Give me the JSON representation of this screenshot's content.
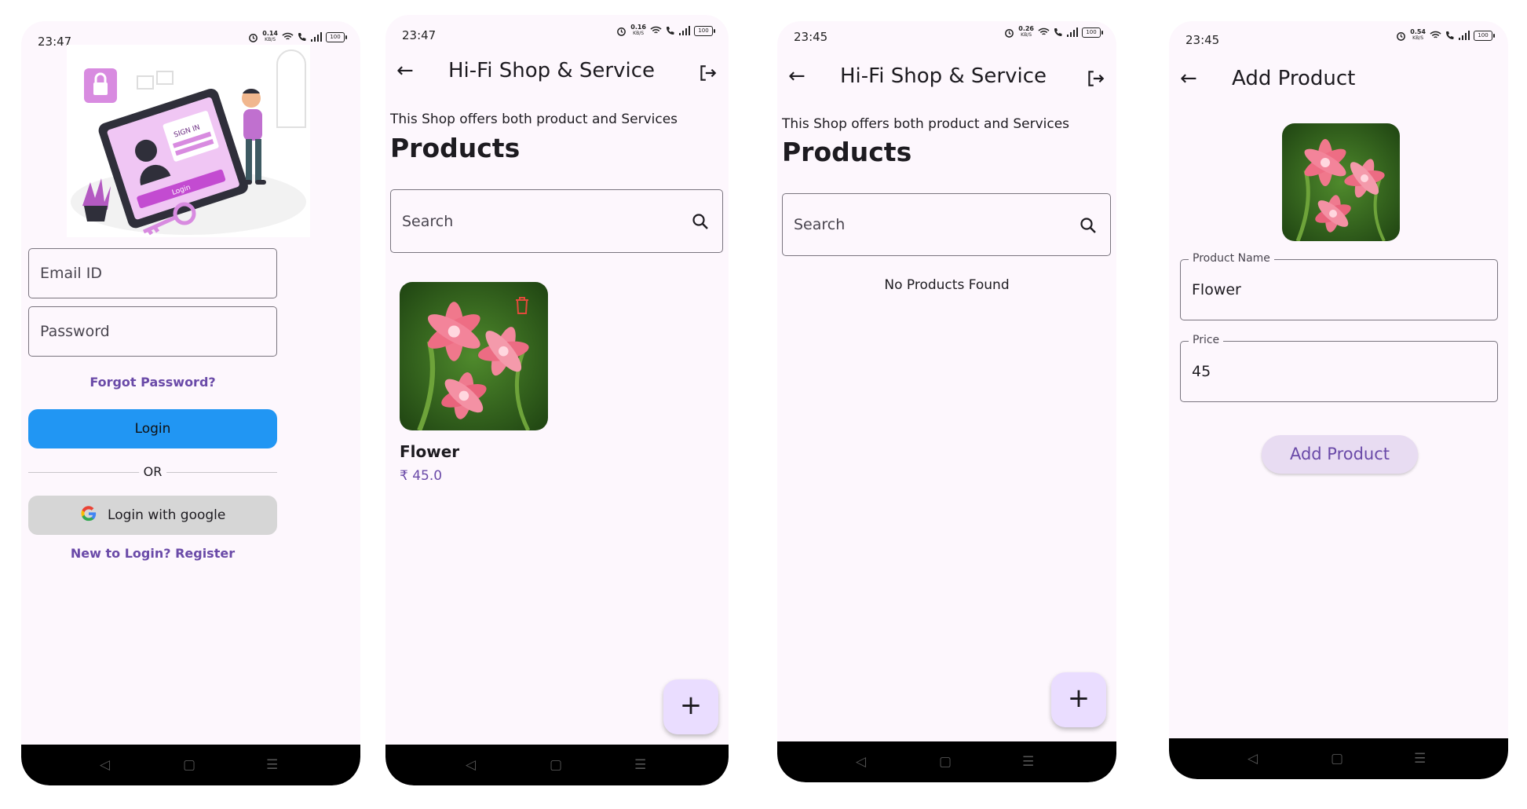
{
  "screen1": {
    "status": {
      "time": "23:47",
      "speed": "0.14",
      "speed_unit": "KB/S",
      "battery": "100"
    },
    "illustration": {
      "sign_in": "SIGN IN",
      "login": "Login"
    },
    "email": {
      "placeholder": "Email ID"
    },
    "password": {
      "placeholder": "Password"
    },
    "forgot": "Forgot Password?",
    "login_button": "Login",
    "divider": "OR",
    "google_button": "Login with google",
    "register": "New to Login? Register"
  },
  "screen2": {
    "status": {
      "time": "23:47",
      "speed": "0.16",
      "speed_unit": "KB/S",
      "battery": "100"
    },
    "title": "Hi-Fi Shop & Service",
    "subtitle": "This Shop offers both product and Services",
    "heading": "Products",
    "search_placeholder": "Search",
    "product": {
      "name": "Flower",
      "price": "₹ 45.0"
    }
  },
  "screen3": {
    "status": {
      "time": "23:45",
      "speed": "0.26",
      "speed_unit": "KB/S",
      "battery": "100"
    },
    "title": "Hi-Fi Shop & Service",
    "subtitle": "This Shop offers both product and Services",
    "heading": "Products",
    "search_placeholder": "Search",
    "empty": "No Products Found"
  },
  "screen4": {
    "status": {
      "time": "23:45",
      "speed": "0.54",
      "speed_unit": "KB/S",
      "battery": "100"
    },
    "title": "Add Product",
    "name_label": "Product Name",
    "name_value": "Flower",
    "price_label": "Price",
    "price_value": "45",
    "submit": "Add Product"
  },
  "icons": {
    "back": "arrow-left-icon",
    "logout": "logout-icon",
    "search": "search-icon",
    "add": "plus-icon",
    "delete": "trash-icon",
    "google": "google-icon"
  },
  "colors": {
    "primary": "#2196f3",
    "accent": "#6a4aa8",
    "background": "#fdf7fd",
    "fab": "#eaddff",
    "google_button": "#d6d6d6",
    "delete": "#e24a3b"
  }
}
